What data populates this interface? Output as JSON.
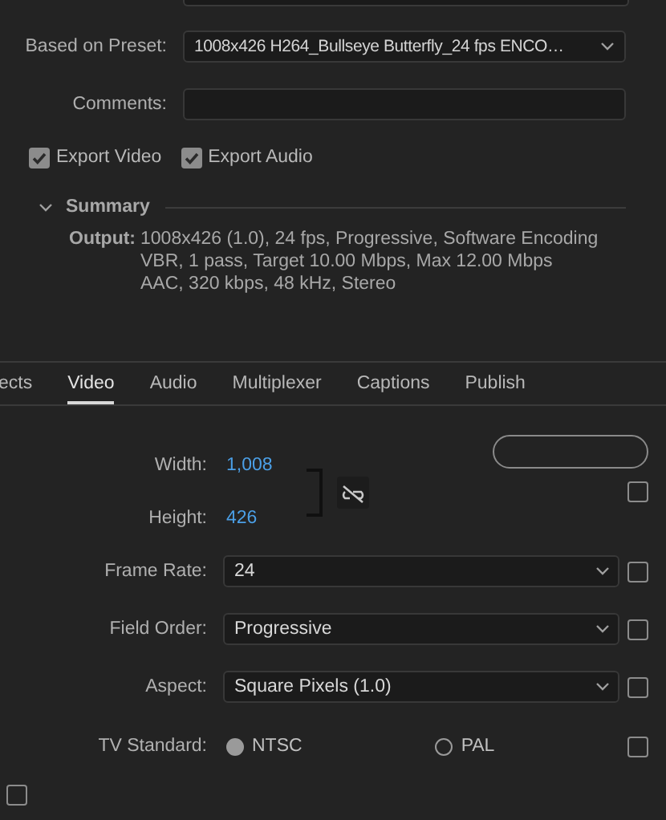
{
  "preset": {
    "label": "Based on Preset:",
    "value": "1008x426 H264_Bullseye Butterfly_24 fps ENCO…"
  },
  "comments": {
    "label": "Comments:"
  },
  "exports": [
    {
      "label": "Export Video",
      "checked": true
    },
    {
      "label": "Export Audio",
      "checked": true
    }
  ],
  "summary": {
    "title": "Summary",
    "expanded": true,
    "label": "Output:",
    "lines": [
      "1008x426 (1.0), 24 fps, Progressive, Software Encoding",
      "VBR, 1 pass, Target 10.00 Mbps, Max 12.00 Mbps",
      "AAC, 320 kbps, 48 kHz, Stereo"
    ]
  },
  "tabs": [
    {
      "label": "ects",
      "selected": false
    },
    {
      "label": "Video",
      "selected": true
    },
    {
      "label": "Audio",
      "selected": false
    },
    {
      "label": "Multiplexer",
      "selected": false
    },
    {
      "label": "Captions",
      "selected": false
    },
    {
      "label": "Publish",
      "selected": false
    }
  ],
  "video": {
    "width": {
      "label": "Width:",
      "value": "1,008"
    },
    "height": {
      "label": "Height:",
      "value": "426"
    },
    "linked": false,
    "checked": false,
    "selects": [
      {
        "label": "Frame Rate:",
        "value": "24",
        "checked": false
      },
      {
        "label": "Field Order:",
        "value": "Progressive",
        "checked": false
      },
      {
        "label": "Aspect:",
        "value": "Square Pixels (1.0)",
        "checked": false
      }
    ],
    "tv_standard": {
      "label": "TV Standard:",
      "options": [
        {
          "label": "NTSC",
          "selected": true
        },
        {
          "label": "PAL",
          "selected": false
        }
      ],
      "checked": false
    }
  },
  "render_max_depth": {
    "checked": false
  }
}
